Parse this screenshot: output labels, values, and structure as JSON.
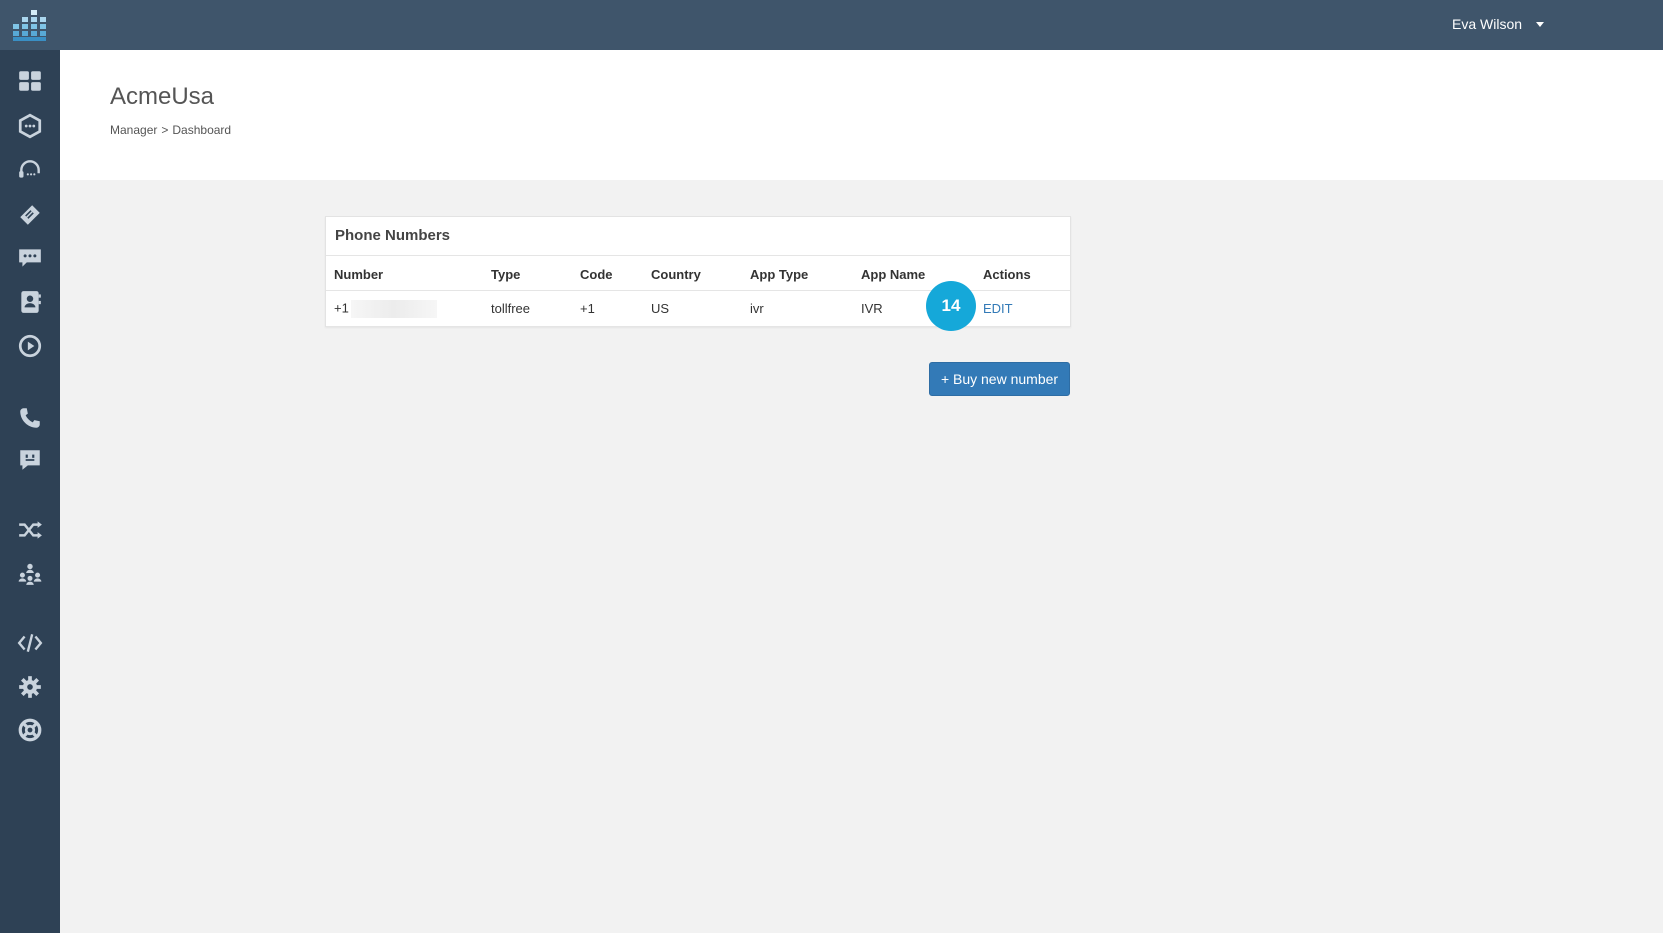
{
  "topbar": {
    "user_name": "Eva Wilson",
    "background": "#3f556b",
    "logo_icon": "grid-bars-logo"
  },
  "sidebar": {
    "background": "#2e4155",
    "items": [
      {
        "icon": "dashboard-grid-icon"
      },
      {
        "icon": "hexagon-chat-icon"
      },
      {
        "icon": "headset-icon"
      },
      {
        "icon": "ticket-icon"
      },
      {
        "icon": "chat-bubble-icon"
      },
      {
        "icon": "contacts-book-icon"
      },
      {
        "icon": "play-circle-icon"
      },
      {
        "icon": "phone-icon"
      },
      {
        "icon": "message-square-icon"
      },
      {
        "icon": "shuffle-icon"
      },
      {
        "icon": "team-icon"
      },
      {
        "icon": "code-icon"
      },
      {
        "icon": "gear-icon"
      },
      {
        "icon": "lifebuoy-icon"
      }
    ]
  },
  "header": {
    "title": "AcmeUsa",
    "breadcrumb": {
      "parent": "Manager",
      "separator": ">",
      "current": "Dashboard"
    }
  },
  "phone_numbers": {
    "title": "Phone Numbers",
    "columns": [
      "Number",
      "Type",
      "Code",
      "Country",
      "App Type",
      "App Name",
      "Actions"
    ],
    "rows": [
      {
        "number_prefix": "+1",
        "type": "tollfree",
        "code": "+1",
        "country": "US",
        "app_type": "ivr",
        "app_name": "IVR",
        "action": "EDIT"
      }
    ]
  },
  "step_badge": "14",
  "buy_button_label": "+ Buy new number",
  "colors": {
    "accent": "#337ab7",
    "badge": "#15a8d9",
    "page_bg": "#f2f2f2"
  }
}
